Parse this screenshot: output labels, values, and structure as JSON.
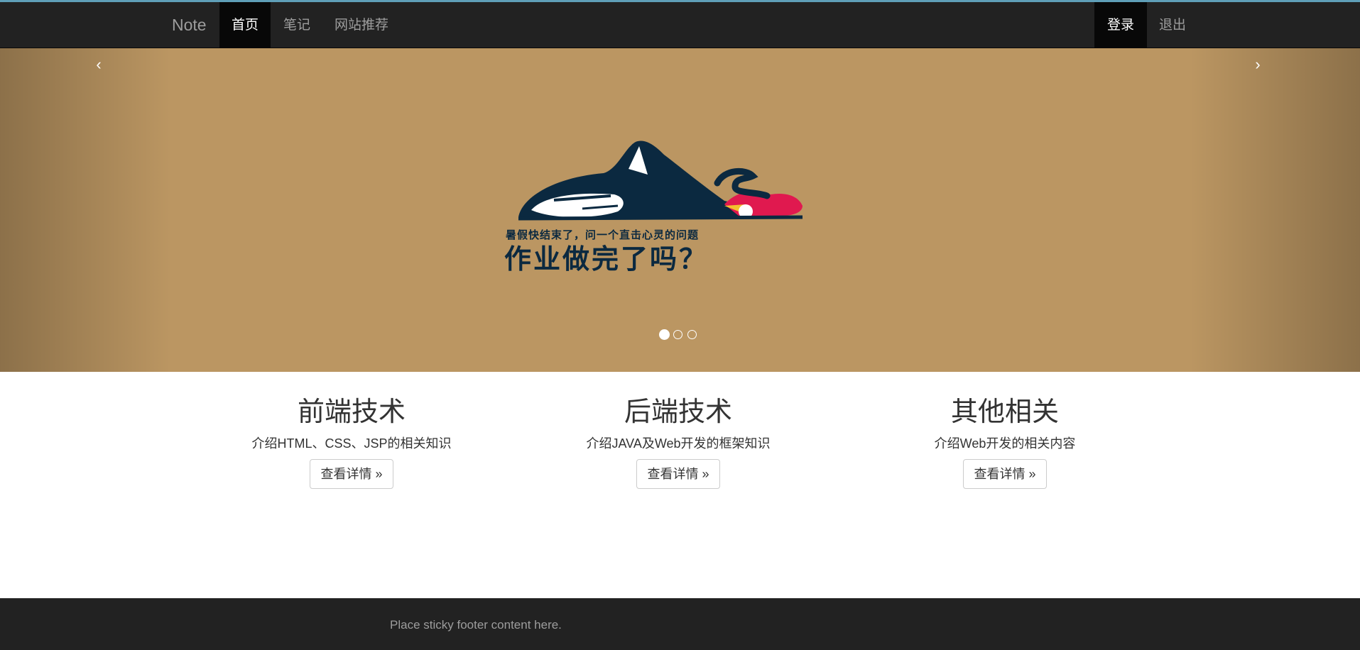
{
  "navbar": {
    "brand": "Note",
    "items": [
      {
        "label": "首页",
        "active": true
      },
      {
        "label": "笔记",
        "active": false
      },
      {
        "label": "网站推荐",
        "active": false
      }
    ],
    "right_items": [
      {
        "label": "登录",
        "active": true
      },
      {
        "label": "退出",
        "active": false
      }
    ]
  },
  "carousel": {
    "prev_glyph": "‹",
    "next_glyph": "›",
    "caption_small": "暑假快结束了，问一个直击心灵的问题",
    "caption_big": "作业做完了吗？",
    "slide_count": 3,
    "active_slide": 0,
    "background_color": "#bb9662"
  },
  "features": [
    {
      "title": "前端技术",
      "description": "介绍HTML、CSS、JSP的相关知识",
      "button": "查看详情 »"
    },
    {
      "title": "后端技术",
      "description": "介绍JAVA及Web开发的框架知识",
      "button": "查看详情 »"
    },
    {
      "title": "其他相关",
      "description": "介绍Web开发的相关内容",
      "button": "查看详情 »"
    }
  ],
  "footer": {
    "text": "Place sticky footer content here."
  },
  "colors": {
    "navbar": "#222222",
    "accent": "#5f9fb8",
    "logo_dark": "#0b2940",
    "logo_red": "#e0194f"
  }
}
